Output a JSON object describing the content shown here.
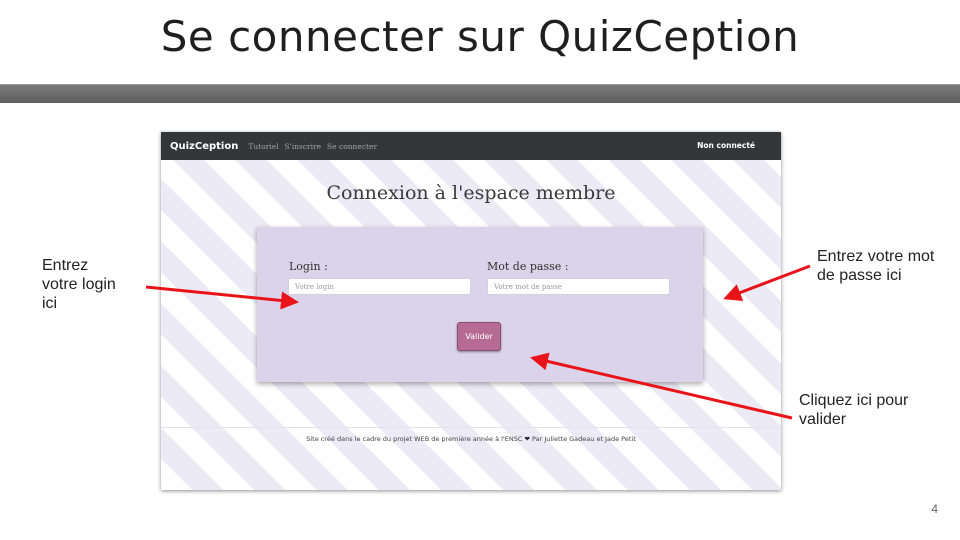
{
  "slide": {
    "title": "Se connecter sur QuizCeption",
    "page_number": "4"
  },
  "app": {
    "navbar": {
      "brand": "QuizCeption",
      "links": [
        "Tutoriel",
        "S'inscrire",
        "Se connecter"
      ],
      "status": "Non connecté"
    },
    "heading": "Connexion à l'espace membre",
    "form": {
      "login_label": "Login :",
      "login_placeholder": "Votre login",
      "password_label": "Mot de passe :",
      "password_placeholder": "Votre mot de passe",
      "submit_label": "Valider"
    },
    "footer": {
      "text_before": "Site créé dans le cadre du projet WEB de première année à l'ENSC",
      "heart_icon": "heart-icon",
      "text_after": "Par Juliette Gadeau et Jade Petit"
    }
  },
  "annotations": {
    "login": [
      "Entrez",
      "votre login",
      "ici"
    ],
    "password": [
      "Entrez votre mot",
      "de passe ici"
    ],
    "submit": [
      "Cliquez ici pour",
      "valider"
    ]
  },
  "colors": {
    "navbar": "#34373a",
    "card": "#dbd3e9",
    "button": "#b56b93",
    "arrow": "#e8141a"
  }
}
